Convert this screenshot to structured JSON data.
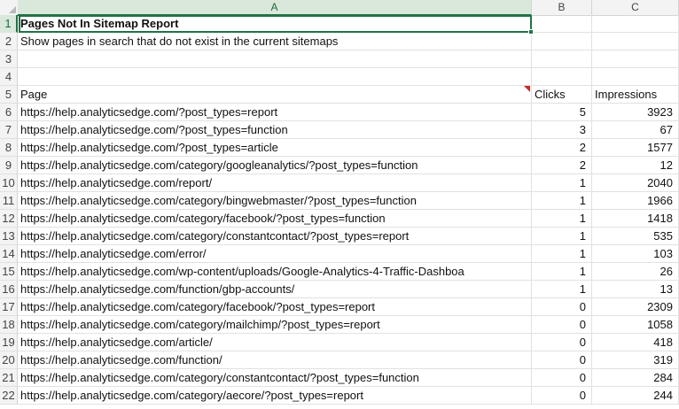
{
  "columns": [
    "A",
    "B",
    "C"
  ],
  "rows": [
    {
      "n": "1",
      "page": "Pages Not In Sitemap Report",
      "clicks": "",
      "impressions": "",
      "bold": true
    },
    {
      "n": "2",
      "page": "Show pages in search that do not exist in the current sitemaps",
      "clicks": "",
      "impressions": ""
    },
    {
      "n": "3",
      "page": "",
      "clicks": "",
      "impressions": ""
    },
    {
      "n": "4",
      "page": "",
      "clicks": "",
      "impressions": ""
    },
    {
      "n": "5",
      "page": "Page",
      "clicks": "Clicks",
      "impressions": "Impressions",
      "header": true
    },
    {
      "n": "6",
      "page": "https://help.analyticsedge.com/?post_types=report",
      "clicks": "5",
      "impressions": "3923"
    },
    {
      "n": "7",
      "page": "https://help.analyticsedge.com/?post_types=function",
      "clicks": "3",
      "impressions": "67"
    },
    {
      "n": "8",
      "page": "https://help.analyticsedge.com/?post_types=article",
      "clicks": "2",
      "impressions": "1577"
    },
    {
      "n": "9",
      "page": "https://help.analyticsedge.com/category/googleanalytics/?post_types=function",
      "clicks": "2",
      "impressions": "12"
    },
    {
      "n": "10",
      "page": "https://help.analyticsedge.com/report/",
      "clicks": "1",
      "impressions": "2040"
    },
    {
      "n": "11",
      "page": "https://help.analyticsedge.com/category/bingwebmaster/?post_types=function",
      "clicks": "1",
      "impressions": "1966"
    },
    {
      "n": "12",
      "page": "https://help.analyticsedge.com/category/facebook/?post_types=function",
      "clicks": "1",
      "impressions": "1418"
    },
    {
      "n": "13",
      "page": "https://help.analyticsedge.com/category/constantcontact/?post_types=report",
      "clicks": "1",
      "impressions": "535"
    },
    {
      "n": "14",
      "page": "https://help.analyticsedge.com/error/",
      "clicks": "1",
      "impressions": "103"
    },
    {
      "n": "15",
      "page": "https://help.analyticsedge.com/wp-content/uploads/Google-Analytics-4-Traffic-Dashboa",
      "clicks": "1",
      "impressions": "26"
    },
    {
      "n": "16",
      "page": "https://help.analyticsedge.com/function/gbp-accounts/",
      "clicks": "1",
      "impressions": "13"
    },
    {
      "n": "17",
      "page": "https://help.analyticsedge.com/category/facebook/?post_types=report",
      "clicks": "0",
      "impressions": "2309"
    },
    {
      "n": "18",
      "page": "https://help.analyticsedge.com/category/mailchimp/?post_types=report",
      "clicks": "0",
      "impressions": "1058"
    },
    {
      "n": "19",
      "page": "https://help.analyticsedge.com/article/",
      "clicks": "0",
      "impressions": "418"
    },
    {
      "n": "20",
      "page": "https://help.analyticsedge.com/function/",
      "clicks": "0",
      "impressions": "319"
    },
    {
      "n": "21",
      "page": "https://help.analyticsedge.com/category/constantcontact/?post_types=function",
      "clicks": "0",
      "impressions": "284"
    },
    {
      "n": "22",
      "page": "https://help.analyticsedge.com/category/aecore/?post_types=report",
      "clicks": "0",
      "impressions": "244"
    }
  ]
}
